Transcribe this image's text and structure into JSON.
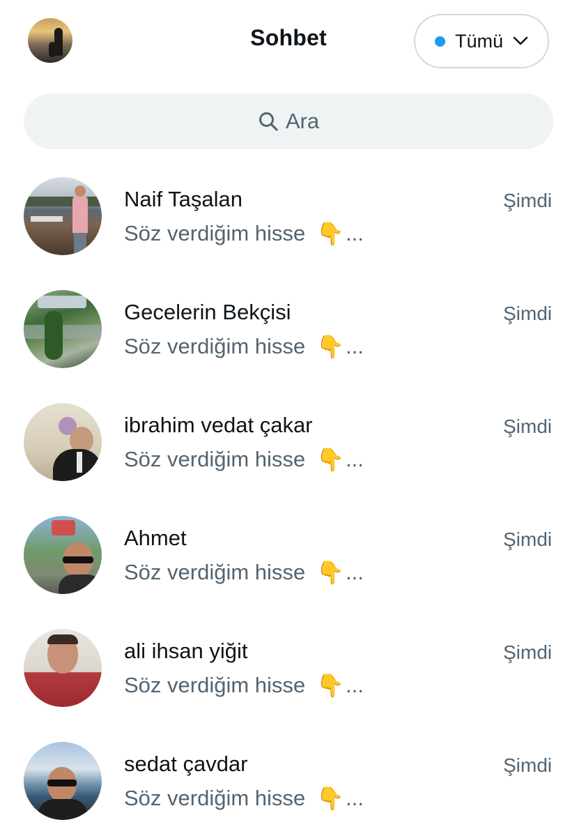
{
  "header": {
    "title": "Sohbet",
    "filter_label": "Tümü",
    "accent_color": "#1d9bf0"
  },
  "search": {
    "placeholder": "Ara"
  },
  "conversations": [
    {
      "name": "Naif Taşalan",
      "time": "Şimdi",
      "preview": "Söz verdiğim hisse",
      "emoji": "👇",
      "ellipsis": "..."
    },
    {
      "name": "Gecelerin Bekçisi",
      "time": "Şimdi",
      "preview": "Söz verdiğim hisse",
      "emoji": "👇",
      "ellipsis": "..."
    },
    {
      "name": "ibrahim vedat çakar",
      "time": "Şimdi",
      "preview": "Söz verdiğim hisse",
      "emoji": "👇",
      "ellipsis": "..."
    },
    {
      "name": "Ahmet",
      "time": "Şimdi",
      "preview": "Söz verdiğim hisse",
      "emoji": "👇",
      "ellipsis": "..."
    },
    {
      "name": "ali ihsan yiğit",
      "time": "Şimdi",
      "preview": "Söz verdiğim hisse",
      "emoji": "👇",
      "ellipsis": "..."
    },
    {
      "name": "sedat çavdar",
      "time": "Şimdi",
      "preview": "Söz verdiğim hisse",
      "emoji": "👇",
      "ellipsis": "..."
    }
  ]
}
